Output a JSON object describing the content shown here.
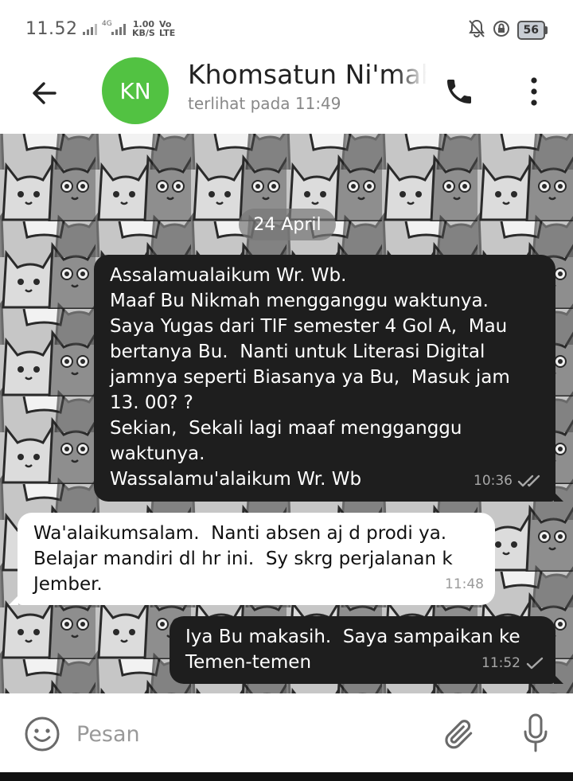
{
  "status_bar": {
    "time": "11.52",
    "net_type": "4G",
    "speed_value": "1.00",
    "speed_unit": "KB/S",
    "volte_top": "Vo",
    "volte_bottom": "LTE",
    "battery": "56"
  },
  "header": {
    "avatar_initials": "KN",
    "avatar_color": "#52c242",
    "contact_name": "Khomsatun Ni'mah",
    "last_seen": "terlihat pada  11:49"
  },
  "chat": {
    "date_chip": "24 April",
    "messages": [
      {
        "direction": "out",
        "text": "Assalamualaikum Wr. Wb.\nMaaf Bu Nikmah mengganggu waktunya.\nSaya Yugas dari TIF semester 4 Gol A,  Mau bertanya Bu.  Nanti untuk Literasi Digital jamnya seperti Biasanya ya Bu,  Masuk jam 13. 00? ?\nSekian,  Sekali lagi maaf mengganggu waktunya.\nWassalamu'alaikum Wr. Wb",
        "time": "10:36",
        "status": "read"
      },
      {
        "direction": "in",
        "text": "Wa'alaikumsalam.  Nanti absen aj d prodi ya.  Belajar mandiri dl hr ini.  Sy skrg perjalanan k Jember.",
        "time": "11:48"
      },
      {
        "direction": "out",
        "text": "Iya Bu makasih.  Saya sampaikan ke Temen-temen",
        "time": "11:52",
        "status": "sent"
      }
    ]
  },
  "composer": {
    "placeholder": "Pesan"
  },
  "icons": {
    "back": "arrow-left-icon",
    "call": "phone-icon",
    "menu": "more-vertical-icon",
    "emoji": "smiley-icon",
    "attach": "paperclip-icon",
    "mic": "microphone-icon"
  },
  "colors": {
    "outgoing_bubble": "#1e1e1e",
    "incoming_bubble": "#ffffff",
    "wallpaper": "#c9c9c9"
  }
}
